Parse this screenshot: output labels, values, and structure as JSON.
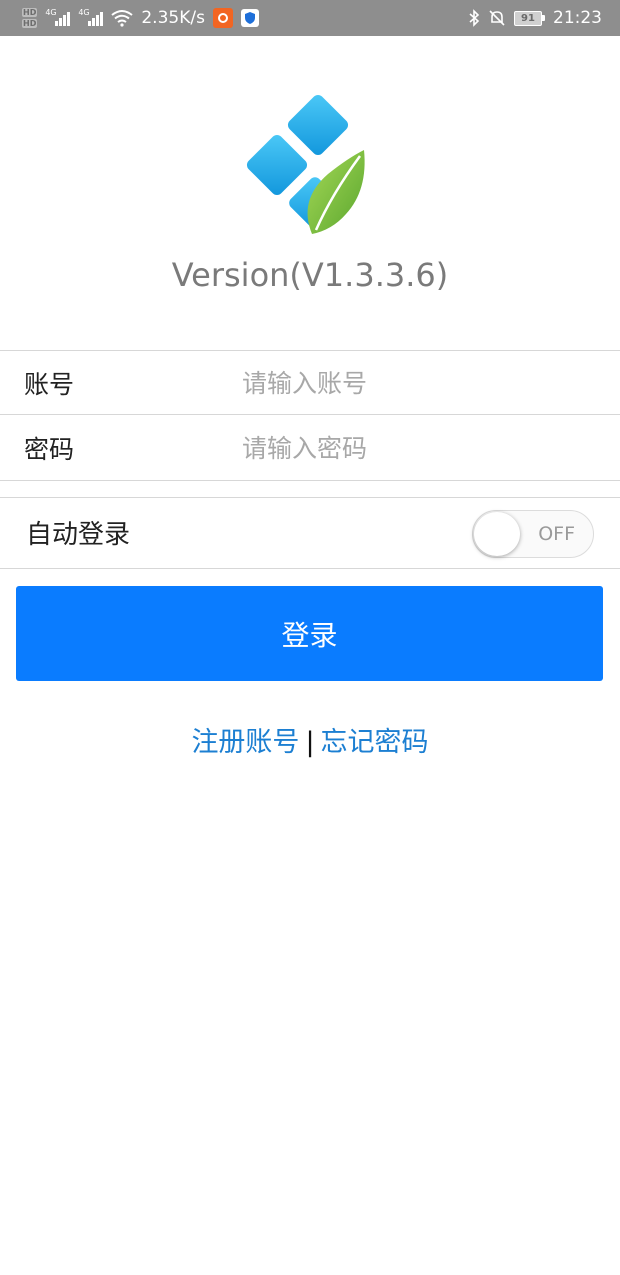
{
  "status_bar": {
    "hd_top": "HD",
    "hd_bottom": "HD",
    "net_tag_1": "4G",
    "net_tag_2": "4G",
    "speed": "2.35K/s",
    "battery": "91",
    "time": "21:23"
  },
  "version_text": "Version(V1.3.3.6)",
  "form": {
    "account_label": "账号",
    "account_placeholder": "请输入账号",
    "password_label": "密码",
    "password_placeholder": "请输入密码"
  },
  "auto_login": {
    "label": "自动登录",
    "toggle_text": "OFF",
    "enabled": false
  },
  "login_button": "登录",
  "links": {
    "register": "注册账号",
    "separator": "|",
    "forgot": "忘记密码"
  },
  "colors": {
    "primary": "#0a7cff",
    "link": "#1c7fd2",
    "logo_blue": "#1fa9e8",
    "logo_green": "#7cc242"
  }
}
